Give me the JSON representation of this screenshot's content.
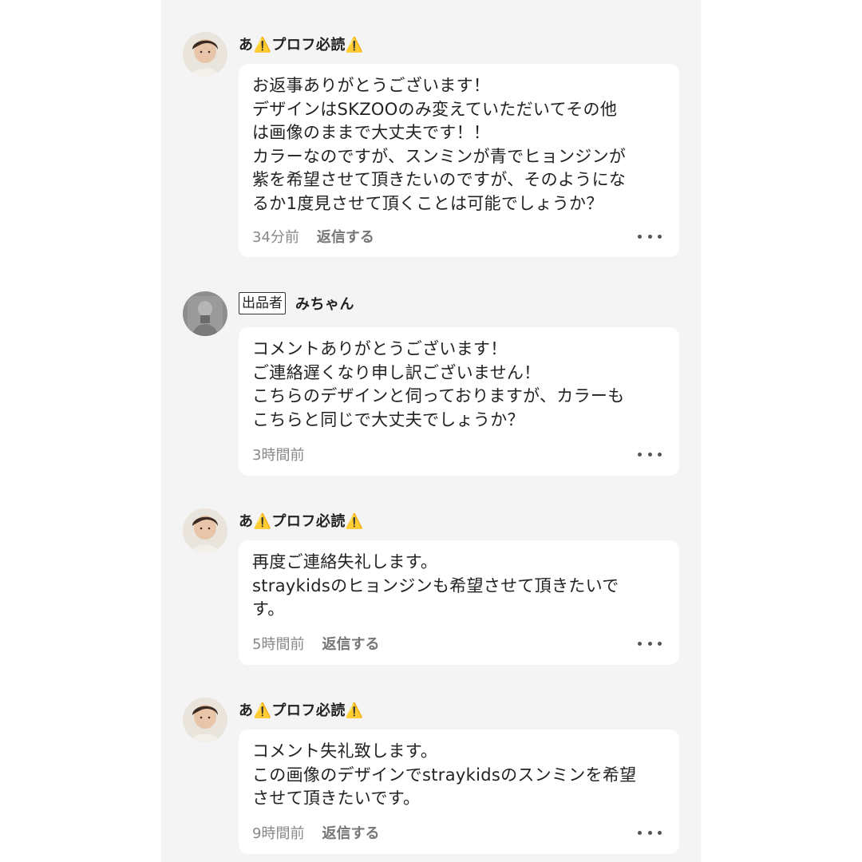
{
  "comments": [
    {
      "username": "あ⚠️プロフ必読⚠️",
      "seller_badge": null,
      "body": "お返事ありがとうございます！\nデザインはSKZOOのみ変えていただいてその他\nは画像のままで大丈夫です！！\nカラーなのですが、スンミンが青でヒョンジンが\n紫を希望させて頂きたいのですが、そのようにな\nるか1度見させて頂くことは可能でしょうか？",
      "timestamp": "34分前",
      "reply_label": "返信する"
    },
    {
      "username": "みちゃん",
      "seller_badge": "出品者",
      "body": "コメントありがとうございます！\nご連絡遅くなり申し訳ございません！\nこちらのデザインと伺っておりますが、カラーも\nこちらと同じで大丈夫でしょうか？",
      "timestamp": "3時間前",
      "reply_label": null
    },
    {
      "username": "あ⚠️プロフ必読⚠️",
      "seller_badge": null,
      "body": "再度ご連絡失礼します。\nstraykidsのヒョンジンも希望させて頂きたいで\nす。",
      "timestamp": "5時間前",
      "reply_label": "返信する"
    },
    {
      "username": "あ⚠️プロフ必読⚠️",
      "seller_badge": null,
      "body": "コメント失礼致します。\nこの画像のデザインでstraykidsのスンミンを希望\nさせて頂きたいです。",
      "timestamp": "9時間前",
      "reply_label": "返信する"
    }
  ],
  "colors": {
    "page_background": "#ffffff",
    "column_background": "#f4f4f4",
    "bubble_background": "#ffffff",
    "text_primary": "#222222",
    "text_muted": "#888888"
  },
  "icons": {
    "buyer_avatar": "user-avatar-photo",
    "seller_avatar": "seller-avatar-photo",
    "more": "more-dots-icon"
  }
}
